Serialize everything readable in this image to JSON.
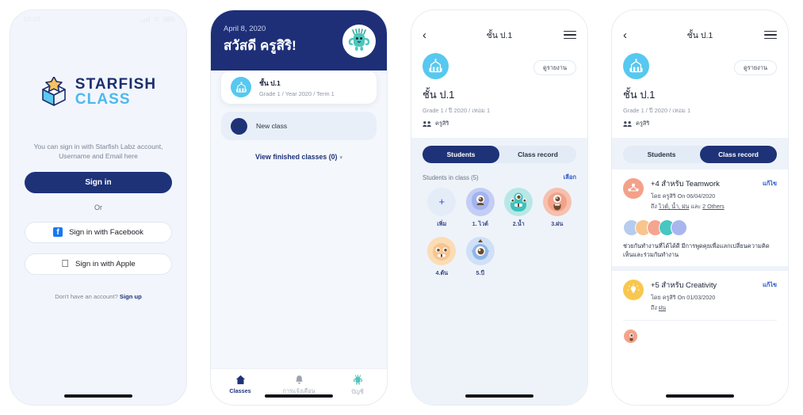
{
  "screens": {
    "signin": {
      "status": {
        "time": "10:25"
      },
      "logo": {
        "line1": "STARFISH",
        "line2": "CLASS",
        "icon": "starfish-box-logo"
      },
      "note": "You can sign in with Starfish Labz account, Username and Email here",
      "primary_button": "Sign in",
      "divider": "Or",
      "facebook_button": "Sign in with Facebook",
      "facebook_icon": "facebook-icon",
      "apple_button": "Sign in with Apple",
      "apple_icon": "apple-icon",
      "signup_prompt": "Don't have an account? ",
      "signup_link": "Sign up"
    },
    "classes": {
      "date": "April 8, 2020",
      "greeting": "สวัสดี ครูสิริ!",
      "avatar_icon": "teacher-monster-avatar",
      "class_card": {
        "icon": "school-building-icon",
        "title": "ชั้น ป.1",
        "subtitle": "Grade 1 / Year 2020 / Term 1"
      },
      "new_class": "New class",
      "new_class_icon": "plus-icon",
      "view_finished": "View finished classes (0)",
      "view_finished_caret": "▾",
      "tabs": [
        {
          "label": "Classes",
          "icon": "home-icon",
          "active": true
        },
        {
          "label": "การแจ้งเตือน",
          "icon": "bell-icon",
          "active": false
        },
        {
          "label": "บัญชี",
          "icon": "account-monster-icon",
          "active": false
        }
      ]
    },
    "class_students": {
      "nav": {
        "back_icon": "chevron-left-icon",
        "title": "ชั้น ป.1",
        "menu_icon": "hamburger-menu-icon"
      },
      "class_icon": "school-building-icon",
      "report_button": "ดูรายงาน",
      "title": "ชั้น ป.1",
      "subtitle": "Grade 1 / ปี 2020 / เทอม 1",
      "teacher_icon": "people-icon",
      "teacher": "ครูสิริ",
      "segmented": [
        {
          "label": "Students",
          "active": true
        },
        {
          "label": "Class record",
          "active": false
        }
      ],
      "students_count_label": "Students in class (5)",
      "select_link": "เลือก",
      "students": [
        {
          "name": "เพิ่ม",
          "avatar": "add-student-icon",
          "color": "#e4ecf8"
        },
        {
          "name": "1. ไวต์",
          "avatar": "monster-avatar-blue",
          "color": "#a8b6f0"
        },
        {
          "name": "2.น้ำ",
          "avatar": "monster-avatar-teal",
          "color": "#49c6c1"
        },
        {
          "name": "3.ฝน",
          "avatar": "monster-avatar-salmon",
          "color": "#f4a58f"
        },
        {
          "name": "4.ต้น",
          "avatar": "monster-avatar-orange",
          "color": "#f8c58e"
        },
        {
          "name": "5.บี",
          "avatar": "monster-avatar-lightblue",
          "color": "#b6cdf0"
        }
      ]
    },
    "class_record": {
      "nav": {
        "back_icon": "chevron-left-icon",
        "title": "ชั้น ป.1",
        "menu_icon": "hamburger-menu-icon"
      },
      "class_icon": "school-building-icon",
      "report_button": "ดูรายงาน",
      "title": "ชั้น ป.1",
      "subtitle": "Grade 1 / ปี 2020 / เทอม 1",
      "teacher_icon": "people-icon",
      "teacher": "ครูสิริ",
      "segmented": [
        {
          "label": "Students",
          "active": false
        },
        {
          "label": "Class record",
          "active": true
        }
      ],
      "records": [
        {
          "badge_icon": "teamwork-icon",
          "badge_color": "#f4a58f",
          "title": "+4 สำหรับ Teamwork",
          "edit_label": "แก้ไข",
          "by": "โดย ครูสิริ On 06/04/2020",
          "to_prefix": "ถึง ",
          "to_names": "ไวต์, น้ำ, ฝน",
          "to_and": " และ ",
          "to_others": "2 Others",
          "avatars": [
            "#b6cdf0",
            "#f8c58e",
            "#f4a58f",
            "#49c6c1",
            "#a8b6f0"
          ],
          "note": "ช่วยกันทำงานที่ได้ได้ดี มีการพูดคุยเพื่อแลกเปลี่ยนความคิดเห็นและร่วมกันทำงาน"
        },
        {
          "badge_icon": "creativity-lightbulb-icon",
          "badge_color": "#f9c74f",
          "title": "+5 สำหรับ Creativity",
          "edit_label": "แก้ไข",
          "by": "โดย ครูสิริ On 01/03/2020",
          "to_prefix": "ถึง ",
          "to_names": "ฝน",
          "to_and": "",
          "to_others": "",
          "avatars": [
            "#f4a58f"
          ],
          "note": ""
        }
      ]
    }
  }
}
